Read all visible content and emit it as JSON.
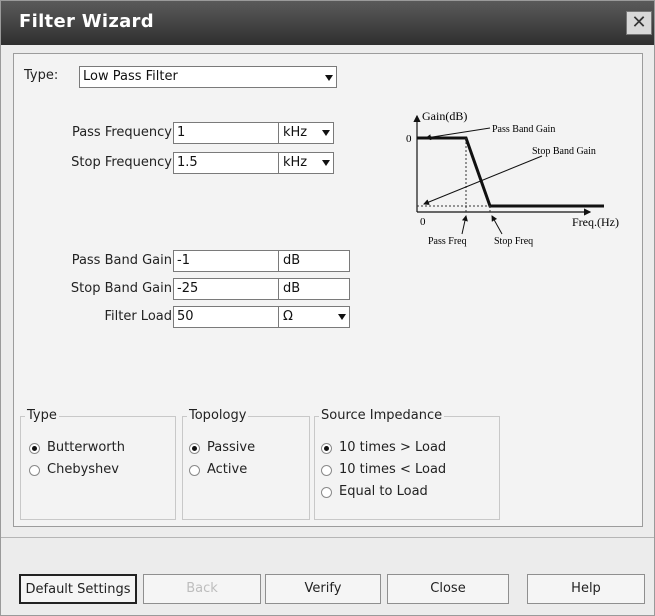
{
  "window": {
    "title": "Filter Wizard",
    "close_glyph": "✕"
  },
  "filter_type": {
    "label": "Type:",
    "value": "Low Pass Filter"
  },
  "frequency": {
    "pass": {
      "label": "Pass Frequency",
      "value": "1",
      "unit": "kHz"
    },
    "stop": {
      "label": "Stop Frequency",
      "value": "1.5",
      "unit": "kHz"
    }
  },
  "gain": {
    "pass": {
      "label": "Pass Band Gain",
      "value": "-1",
      "unit": "dB"
    },
    "stop": {
      "label": "Stop Band Gain",
      "value": "-25",
      "unit": "dB"
    },
    "load": {
      "label": "Filter Load",
      "value": "50",
      "unit": "Ω"
    }
  },
  "diagram": {
    "y_axis": "Gain(dB)",
    "x_axis": "Freq.(Hz)",
    "zero_y": "0",
    "zero_x": "0",
    "pass_band_gain": "Pass Band Gain",
    "stop_band_gain": "Stop Band Gain",
    "pass_freq": "Pass Freq",
    "stop_freq": "Stop Freq"
  },
  "type_group": {
    "title": "Type",
    "options": [
      {
        "label": "Butterworth",
        "selected": true
      },
      {
        "label": "Chebyshev",
        "selected": false
      }
    ]
  },
  "topology_group": {
    "title": "Topology",
    "options": [
      {
        "label": "Passive",
        "selected": true
      },
      {
        "label": "Active",
        "selected": false
      }
    ]
  },
  "impedance_group": {
    "title": "Source Impedance",
    "options": [
      {
        "label": "10 times > Load",
        "selected": true
      },
      {
        "label": "10 times < Load",
        "selected": false
      },
      {
        "label": "Equal to Load",
        "selected": false
      }
    ]
  },
  "buttons": {
    "default_settings": "Default Settings",
    "back": "Back",
    "verify": "Verify",
    "close": "Close",
    "help": "Help"
  }
}
